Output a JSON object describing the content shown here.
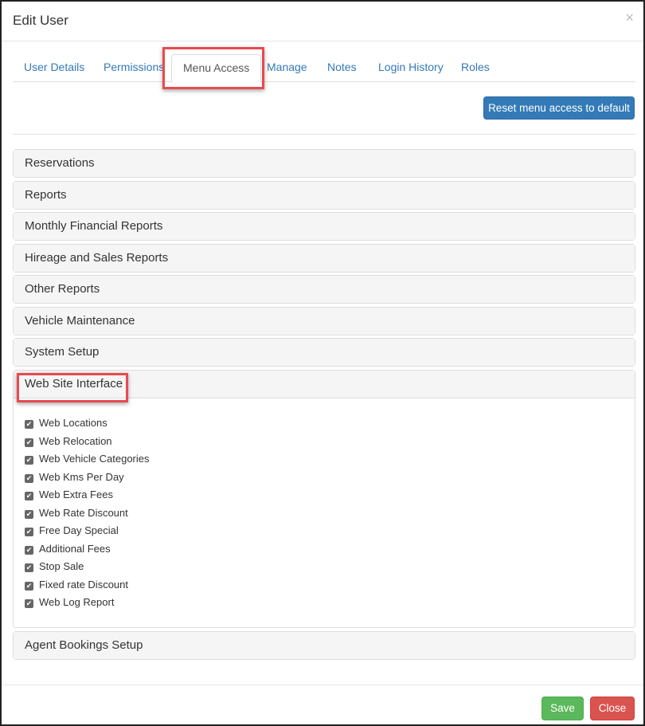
{
  "modal": {
    "title": "Edit User",
    "close_icon": "×"
  },
  "tabs": [
    {
      "label": "User Details"
    },
    {
      "label": "Permissions"
    },
    {
      "label": "Menu Access",
      "active": true
    },
    {
      "label": "Manage"
    },
    {
      "label": "Notes"
    },
    {
      "label": "Login History"
    },
    {
      "label": "Roles"
    }
  ],
  "reset_label": "Reset menu access to default",
  "panels": [
    {
      "label": "Reservations"
    },
    {
      "label": "Reports"
    },
    {
      "label": "Monthly Financial Reports"
    },
    {
      "label": "Hireage and Sales Reports"
    },
    {
      "label": "Other Reports"
    },
    {
      "label": "Vehicle Maintenance"
    },
    {
      "label": "System Setup"
    },
    {
      "label": "Web Site Interface",
      "expanded": true
    },
    {
      "label": "Agent Bookings Setup"
    }
  ],
  "web_items": [
    {
      "label": "Web Locations",
      "checked": true
    },
    {
      "label": "Web Relocation",
      "checked": true
    },
    {
      "label": "Web Vehicle Categories",
      "checked": true
    },
    {
      "label": "Web Kms Per Day",
      "checked": true
    },
    {
      "label": "Web Extra Fees",
      "checked": true
    },
    {
      "label": "Web Rate Discount",
      "checked": true
    },
    {
      "label": "Free Day Special",
      "checked": true
    },
    {
      "label": "Additional Fees",
      "checked": true
    },
    {
      "label": "Stop Sale",
      "checked": true
    },
    {
      "label": "Fixed rate Discount",
      "checked": true
    },
    {
      "label": "Web Log Report",
      "checked": true
    }
  ],
  "footer": {
    "save_label": "Save",
    "close_label": "Close"
  },
  "colors": {
    "primary": "#337ab7",
    "success": "#5cb85c",
    "danger": "#d9534f",
    "highlight": "#e84a4f"
  }
}
